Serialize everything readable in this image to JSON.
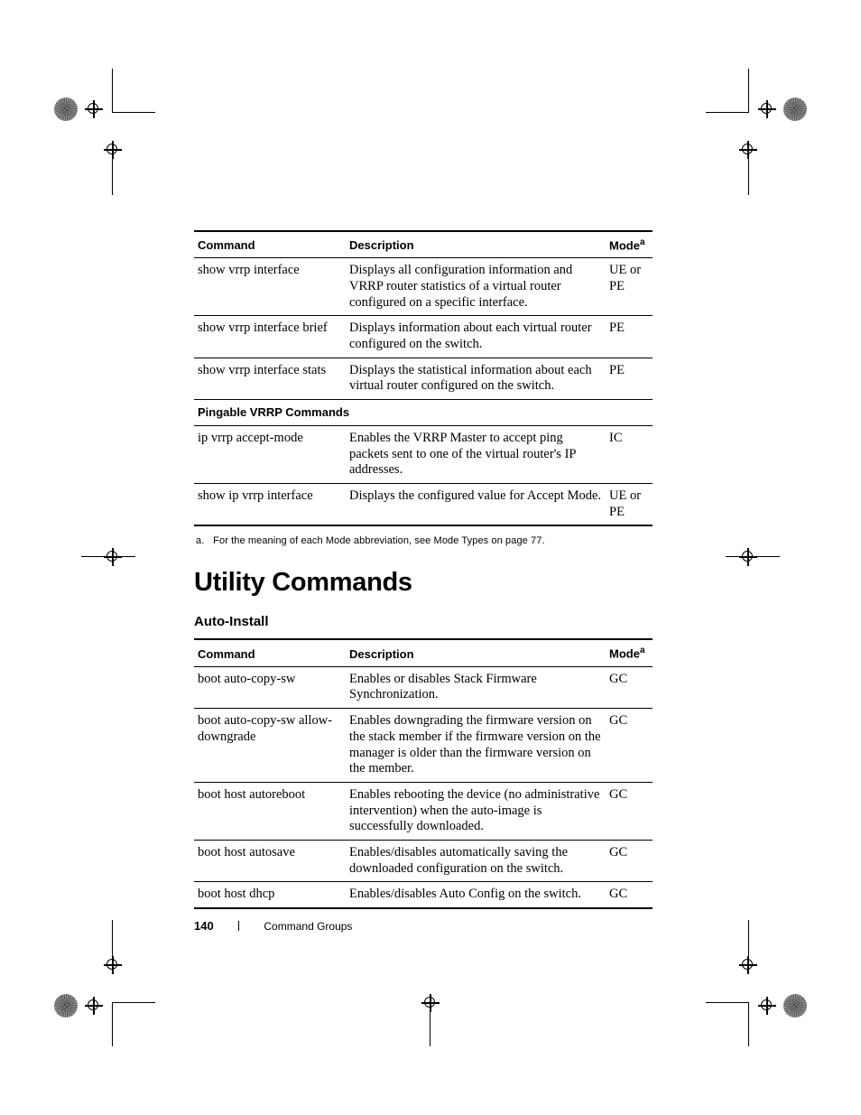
{
  "headers": {
    "command": "Command",
    "description": "Description",
    "mode": "Mode",
    "mode_sup": "a"
  },
  "table1": {
    "rows": [
      {
        "cmd": "show vrrp interface",
        "desc": "Displays all configuration information and VRRP router statistics of a virtual router configured on a specific interface.",
        "mode": "UE or PE"
      },
      {
        "cmd": "show vrrp interface brief",
        "desc": "Displays information about each virtual router configured on the switch.",
        "mode": "PE"
      },
      {
        "cmd": "show vrrp interface stats",
        "desc": "Displays the statistical information about each virtual router configured on the switch.",
        "mode": "PE"
      }
    ],
    "section_label": "Pingable VRRP Commands",
    "rows2": [
      {
        "cmd": "ip vrrp accept-mode",
        "desc": "Enables the VRRP Master to accept ping packets sent to one of the virtual router's IP addresses.",
        "mode": "IC"
      },
      {
        "cmd": "show ip vrrp interface",
        "desc": "Displays the configured value for Accept Mode.",
        "mode": "UE or PE"
      }
    ]
  },
  "footnote": {
    "marker": "a.",
    "text": "For the meaning of each Mode abbreviation, see Mode Types on page 77."
  },
  "section_title": "Utility Commands",
  "subsection_title": "Auto-Install",
  "table2": {
    "rows": [
      {
        "cmd": "boot auto-copy-sw",
        "desc": "Enables or disables Stack Firmware Synchronization.",
        "mode": "GC"
      },
      {
        "cmd": "boot auto-copy-sw allow-downgrade",
        "desc": "Enables downgrading the firmware version on the stack member if the firmware version on the manager is older than the firmware version on the member.",
        "mode": "GC"
      },
      {
        "cmd": "boot host autoreboot",
        "desc": "Enables rebooting the device (no administrative intervention) when the auto-image is successfully downloaded.",
        "mode": "GC"
      },
      {
        "cmd": "boot host autosave",
        "desc": "Enables/disables automatically saving the downloaded configuration on the switch.",
        "mode": "GC"
      },
      {
        "cmd": "boot host dhcp",
        "desc": "Enables/disables Auto Config on the switch.",
        "mode": "GC"
      }
    ]
  },
  "footer": {
    "page_number": "140",
    "section": "Command Groups"
  }
}
